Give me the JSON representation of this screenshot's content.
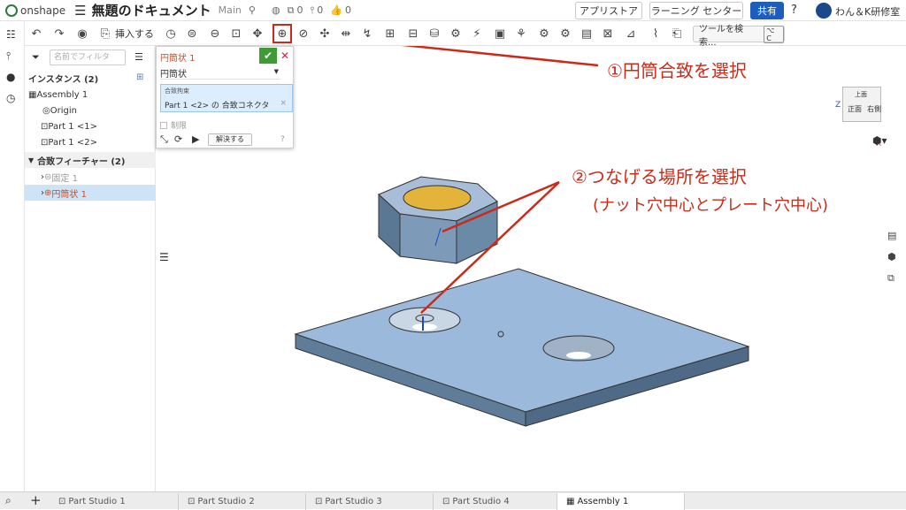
{
  "app": {
    "name": "onshape",
    "doc_title": "無題のドキュメント",
    "branch": "Main",
    "counts": [
      "0",
      "0",
      "0"
    ]
  },
  "top_buttons": {
    "appstore": "アプリストア",
    "learning": "ラーニング センター",
    "share": "共有",
    "user": "わん＆K研修室"
  },
  "toolbar": {
    "insert": "挿入する",
    "search_tools": "ツールを検索...",
    "shortcut": "⌥ C"
  },
  "panel": {
    "filter_placeholder": "名前でフィルタ",
    "instances_header": "インスタンス (2)",
    "assembly": "Assembly 1",
    "origin": "Origin",
    "part1": "Part 1 <1>",
    "part2": "Part 1 <2>",
    "mate_features_header": "合致フィーチャー (2)",
    "fixed": "固定 1",
    "cylindrical": "円筒状 1"
  },
  "dialog": {
    "title": "円筒状 1",
    "type": "円筒状",
    "mates_label": "合致拘束",
    "mates_value": "Part 1 <2> の 合致コネクタ",
    "limit": "制限",
    "solve": "解決する"
  },
  "annotations": {
    "step1": "①円筒合致を選択",
    "step2": "②つなげる場所を選択",
    "step2_sub": "(ナット穴中心とプレート穴中心)"
  },
  "viewcube": {
    "top": "上面",
    "front": "正面",
    "right": "右側",
    "z": "Z",
    "x": "X"
  },
  "tabs": [
    "Part Studio 1",
    "Part Studio 2",
    "Part Studio 3",
    "Part Studio 4",
    "Assembly 1"
  ],
  "colors": {
    "accent_red": "#cc2a18",
    "share_blue": "#1c5ebd",
    "plate": "#8eaed0",
    "nut_inner": "#e4b43a"
  }
}
